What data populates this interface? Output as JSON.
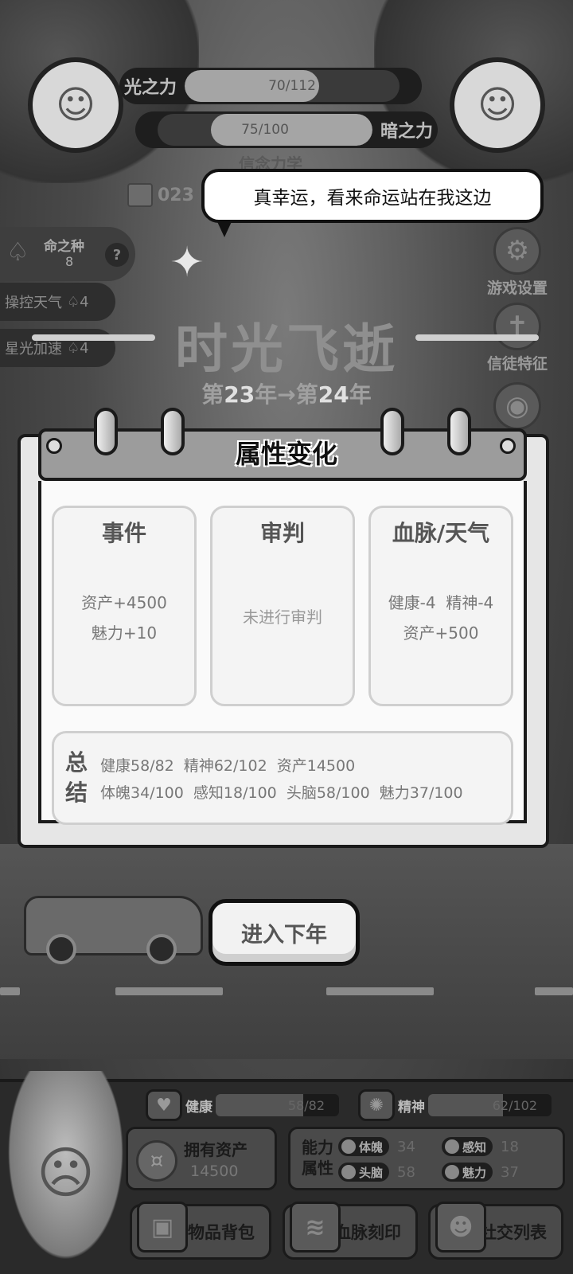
{
  "header": {
    "light_power": {
      "label": "光之力",
      "value": "70/112",
      "fraction": 0.625
    },
    "dark_power": {
      "label": "暗之力",
      "value": "75/100",
      "fraction": 0.75
    },
    "faint_title": "信念力学",
    "calendar_value": "023"
  },
  "speech_bubble": {
    "text": "真幸运，看来命运站在我这边"
  },
  "seed_panel": {
    "label": "命之种",
    "count": "8",
    "help": "?"
  },
  "skills": [
    {
      "label": "操控天气",
      "cost": "4"
    },
    {
      "label": "星光加速",
      "cost": "4"
    }
  ],
  "side_buttons": {
    "settings": "游戏设置",
    "believer": "信徒特征",
    "world": "界"
  },
  "time_passing": {
    "title": "时光飞逝",
    "prefix_from": "第",
    "year_from": "23",
    "arrow": "年→第",
    "year_to": "24",
    "suffix": "年"
  },
  "card": {
    "title": "属性变化",
    "columns": [
      {
        "title": "事件",
        "lines": [
          "资产+4500",
          "魅力+10"
        ]
      },
      {
        "title": "审判",
        "lines": [
          "未进行审判"
        ]
      },
      {
        "title": "血脉/天气",
        "lines": [
          "健康-4  精神-4",
          "资产+500"
        ]
      }
    ],
    "summary": {
      "label_top": "总",
      "label_bottom": "结",
      "line1": "健康58/82  精神62/102  资产14500",
      "line2": "体魄34/100  感知18/100  头脑58/100  魅力37/100"
    }
  },
  "next_button": {
    "label": "进入下年"
  },
  "bottom": {
    "health": {
      "label": "健康",
      "value": "58/82",
      "fraction": 0.707
    },
    "spirit": {
      "label": "精神",
      "value": "62/102",
      "fraction": 0.608
    },
    "assets": {
      "label": "拥有资产",
      "value": "14500"
    },
    "abilities": {
      "title": "能力属性",
      "items": [
        {
          "label": "体魄",
          "value": "34"
        },
        {
          "label": "感知",
          "value": "18"
        },
        {
          "label": "头脑",
          "value": "58"
        },
        {
          "label": "魅力",
          "value": "37"
        }
      ]
    },
    "nav": {
      "inventory": "物品背包",
      "bloodline": "血脉刻印",
      "social": "社交列表"
    }
  },
  "icons": {
    "settings": "gear-icon",
    "believer": "angel-icon",
    "world": "globe-icon",
    "seed": "seed-icon",
    "calendar": "calendar-icon"
  }
}
